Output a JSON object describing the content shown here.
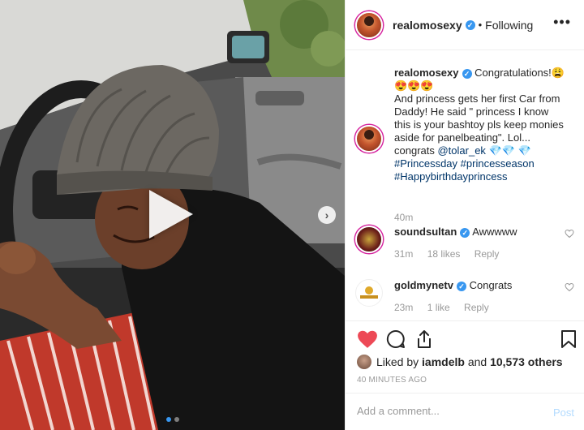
{
  "header": {
    "username": "realomosexy",
    "verified_mark": "✓",
    "separator": "•",
    "follow_status": "Following",
    "more_icon": "more-icon"
  },
  "caption": {
    "username": "realomosexy",
    "emoji_line": "Congratulations!😩",
    "emoji_line2": "😍😍😍",
    "text_parts": [
      "And princess gets her first Car from Daddy! He said \" princess I know this is your bashtoy pls keep monies aside for panelbeating\". Lol... congrats ",
      "@tolar_ek",
      " 💎💎 💎",
      "#Princessday",
      " ",
      "#princesseason",
      " ",
      "#Happybirthdayprincess"
    ],
    "age": "40m"
  },
  "comments": [
    {
      "username": "soundsultan",
      "text": "Awwwww",
      "age": "31m",
      "likes": "18 likes",
      "reply": "Reply"
    },
    {
      "username": "goldmynetv",
      "text": "Congrats",
      "age": "23m",
      "likes": "1 like",
      "reply": "Reply"
    }
  ],
  "actions": {
    "like_icon": "heart-icon",
    "comment_icon": "comment-icon",
    "share_icon": "share-icon",
    "save_icon": "bookmark-icon"
  },
  "likes": {
    "prefix": "Liked by",
    "user": "iamdelb",
    "joiner": "and",
    "others": "10,573 others"
  },
  "timestamp": "40 MINUTES AGO",
  "add_comment": {
    "placeholder": "Add a comment...",
    "post_label": "Post"
  },
  "media": {
    "play_icon": "play-icon",
    "next_icon": "chevron-right-icon",
    "slide_count": 2,
    "active_slide": 1
  },
  "colors": {
    "like_red": "#ed4956",
    "verified_blue": "#3897f0",
    "hashtag": "#003569",
    "post_disabled": "#b3dbff"
  }
}
